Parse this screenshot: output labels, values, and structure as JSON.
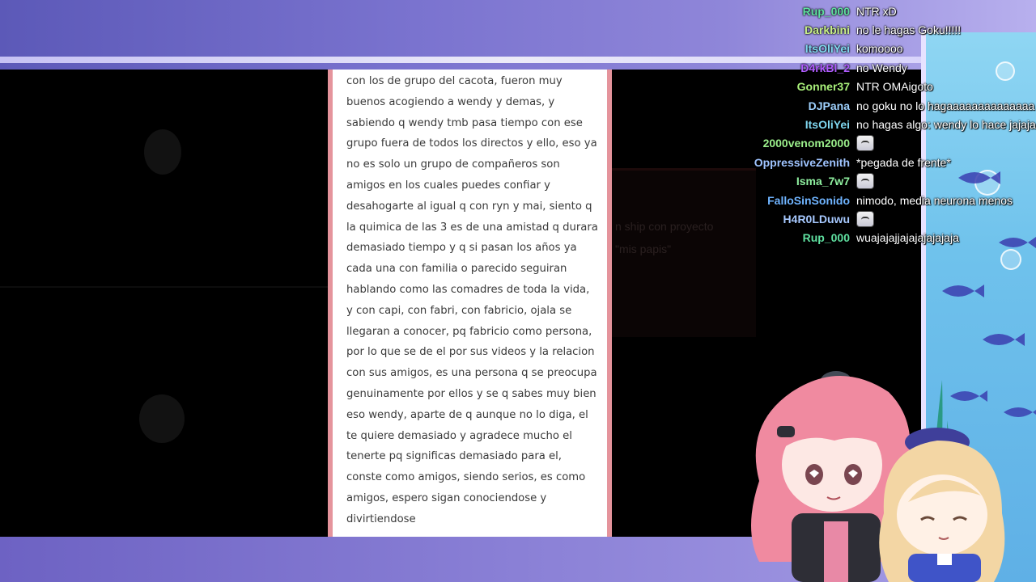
{
  "document": {
    "text": "con los de grupo del cacota, fueron muy\nbuenos acogiendo a wendy y demas, y\nsabiendo q wendy tmb pasa tiempo con ese\ngrupo fuera de todos los directos y ello, eso ya\nno es solo un grupo de compañeros son\namigos en los cuales puedes confiar y\ndesahogarte al igual q con ryn y mai, siento q\nla quimica de las 3 es de una amistad q durara\ndemasiado tiempo y q si pasan los años ya\ncada una con familia o parecido seguiran\nhablando como las comadres de toda la vida,\ny con capi, con fabri, con fabricio, ojala se\nllegaran a conocer, pq fabricio como persona,\npor lo que se de el por sus videos y la relacion\ncon sus amigos, es una persona q se preocupa\ngenuinamente por ellos y se q sabes muy bien\neso wendy, aparte de q aunque no lo diga, el\nte quiere demasiado y agradece mucho el\ntenerte pq significas demasiado para el,\nconste como amigos, siendo serios, es como\namigos, espero sigan conociendose y\ndivirtiendose"
  },
  "background_card": {
    "line1": "n ship con proyecto",
    "line2": "\"mis papis\""
  },
  "chat": {
    "messages": [
      {
        "user": "Rup_000",
        "color": "#5fe0a0",
        "text": "NTR xD"
      },
      {
        "user": "Darkbini",
        "color": "#c9f08a",
        "text": "no le hagas Goku!!!!!"
      },
      {
        "user": "ItsOliYei",
        "color": "#7fd7f0",
        "text": "komoooo"
      },
      {
        "user": "D4rkBl_2",
        "color": "#b05cff",
        "text": "no Wendy"
      },
      {
        "user": "Gonner37",
        "color": "#a9f07a",
        "text": "NTR OMAigoto"
      },
      {
        "user": "DJPana",
        "color": "#9fd2ff",
        "text": "no goku no lo hagaaaaaaaaaaaaaa"
      },
      {
        "user": "ItsOliYei",
        "color": "#7fd7f0",
        "text": "no hagas algo: wendy lo hace jajaja"
      },
      {
        "user": "2000venom2000",
        "color": "#9cf08c",
        "text": "",
        "emote": "cook-emote"
      },
      {
        "user": "OppressiveZenith",
        "color": "#9fc4ff",
        "text": "*pegada de frente*"
      },
      {
        "user": "Isma_7w7",
        "color": "#8ff0a0",
        "text": "",
        "emote": "face-emote"
      },
      {
        "user": "FalloSinSonido",
        "color": "#6fb4ff",
        "text": "nimodo, media neurona menos"
      },
      {
        "user": "H4R0LDuwu",
        "color": "#a7c9ff",
        "text": "",
        "emote": "face-emote"
      },
      {
        "user": "Rup_000",
        "color": "#5fe0a0",
        "text": "wuajajajjajajajajajaja"
      }
    ]
  },
  "colors": {
    "frame": "#6f66c4",
    "doc_border": "#e5949c",
    "sea": "#6fc2ec"
  }
}
